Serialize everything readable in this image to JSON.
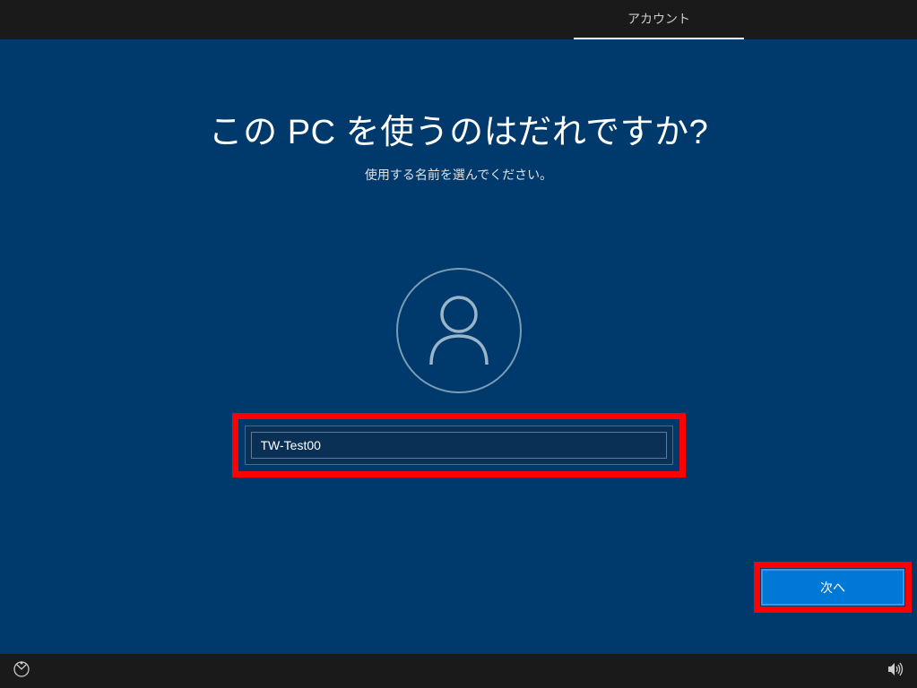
{
  "header": {
    "active_tab": "アカウント"
  },
  "main": {
    "title": "この PC を使うのはだれですか?",
    "subtitle": "使用する名前を選んでください。",
    "username_value": "TW-Test00",
    "next_button_label": "次へ"
  }
}
